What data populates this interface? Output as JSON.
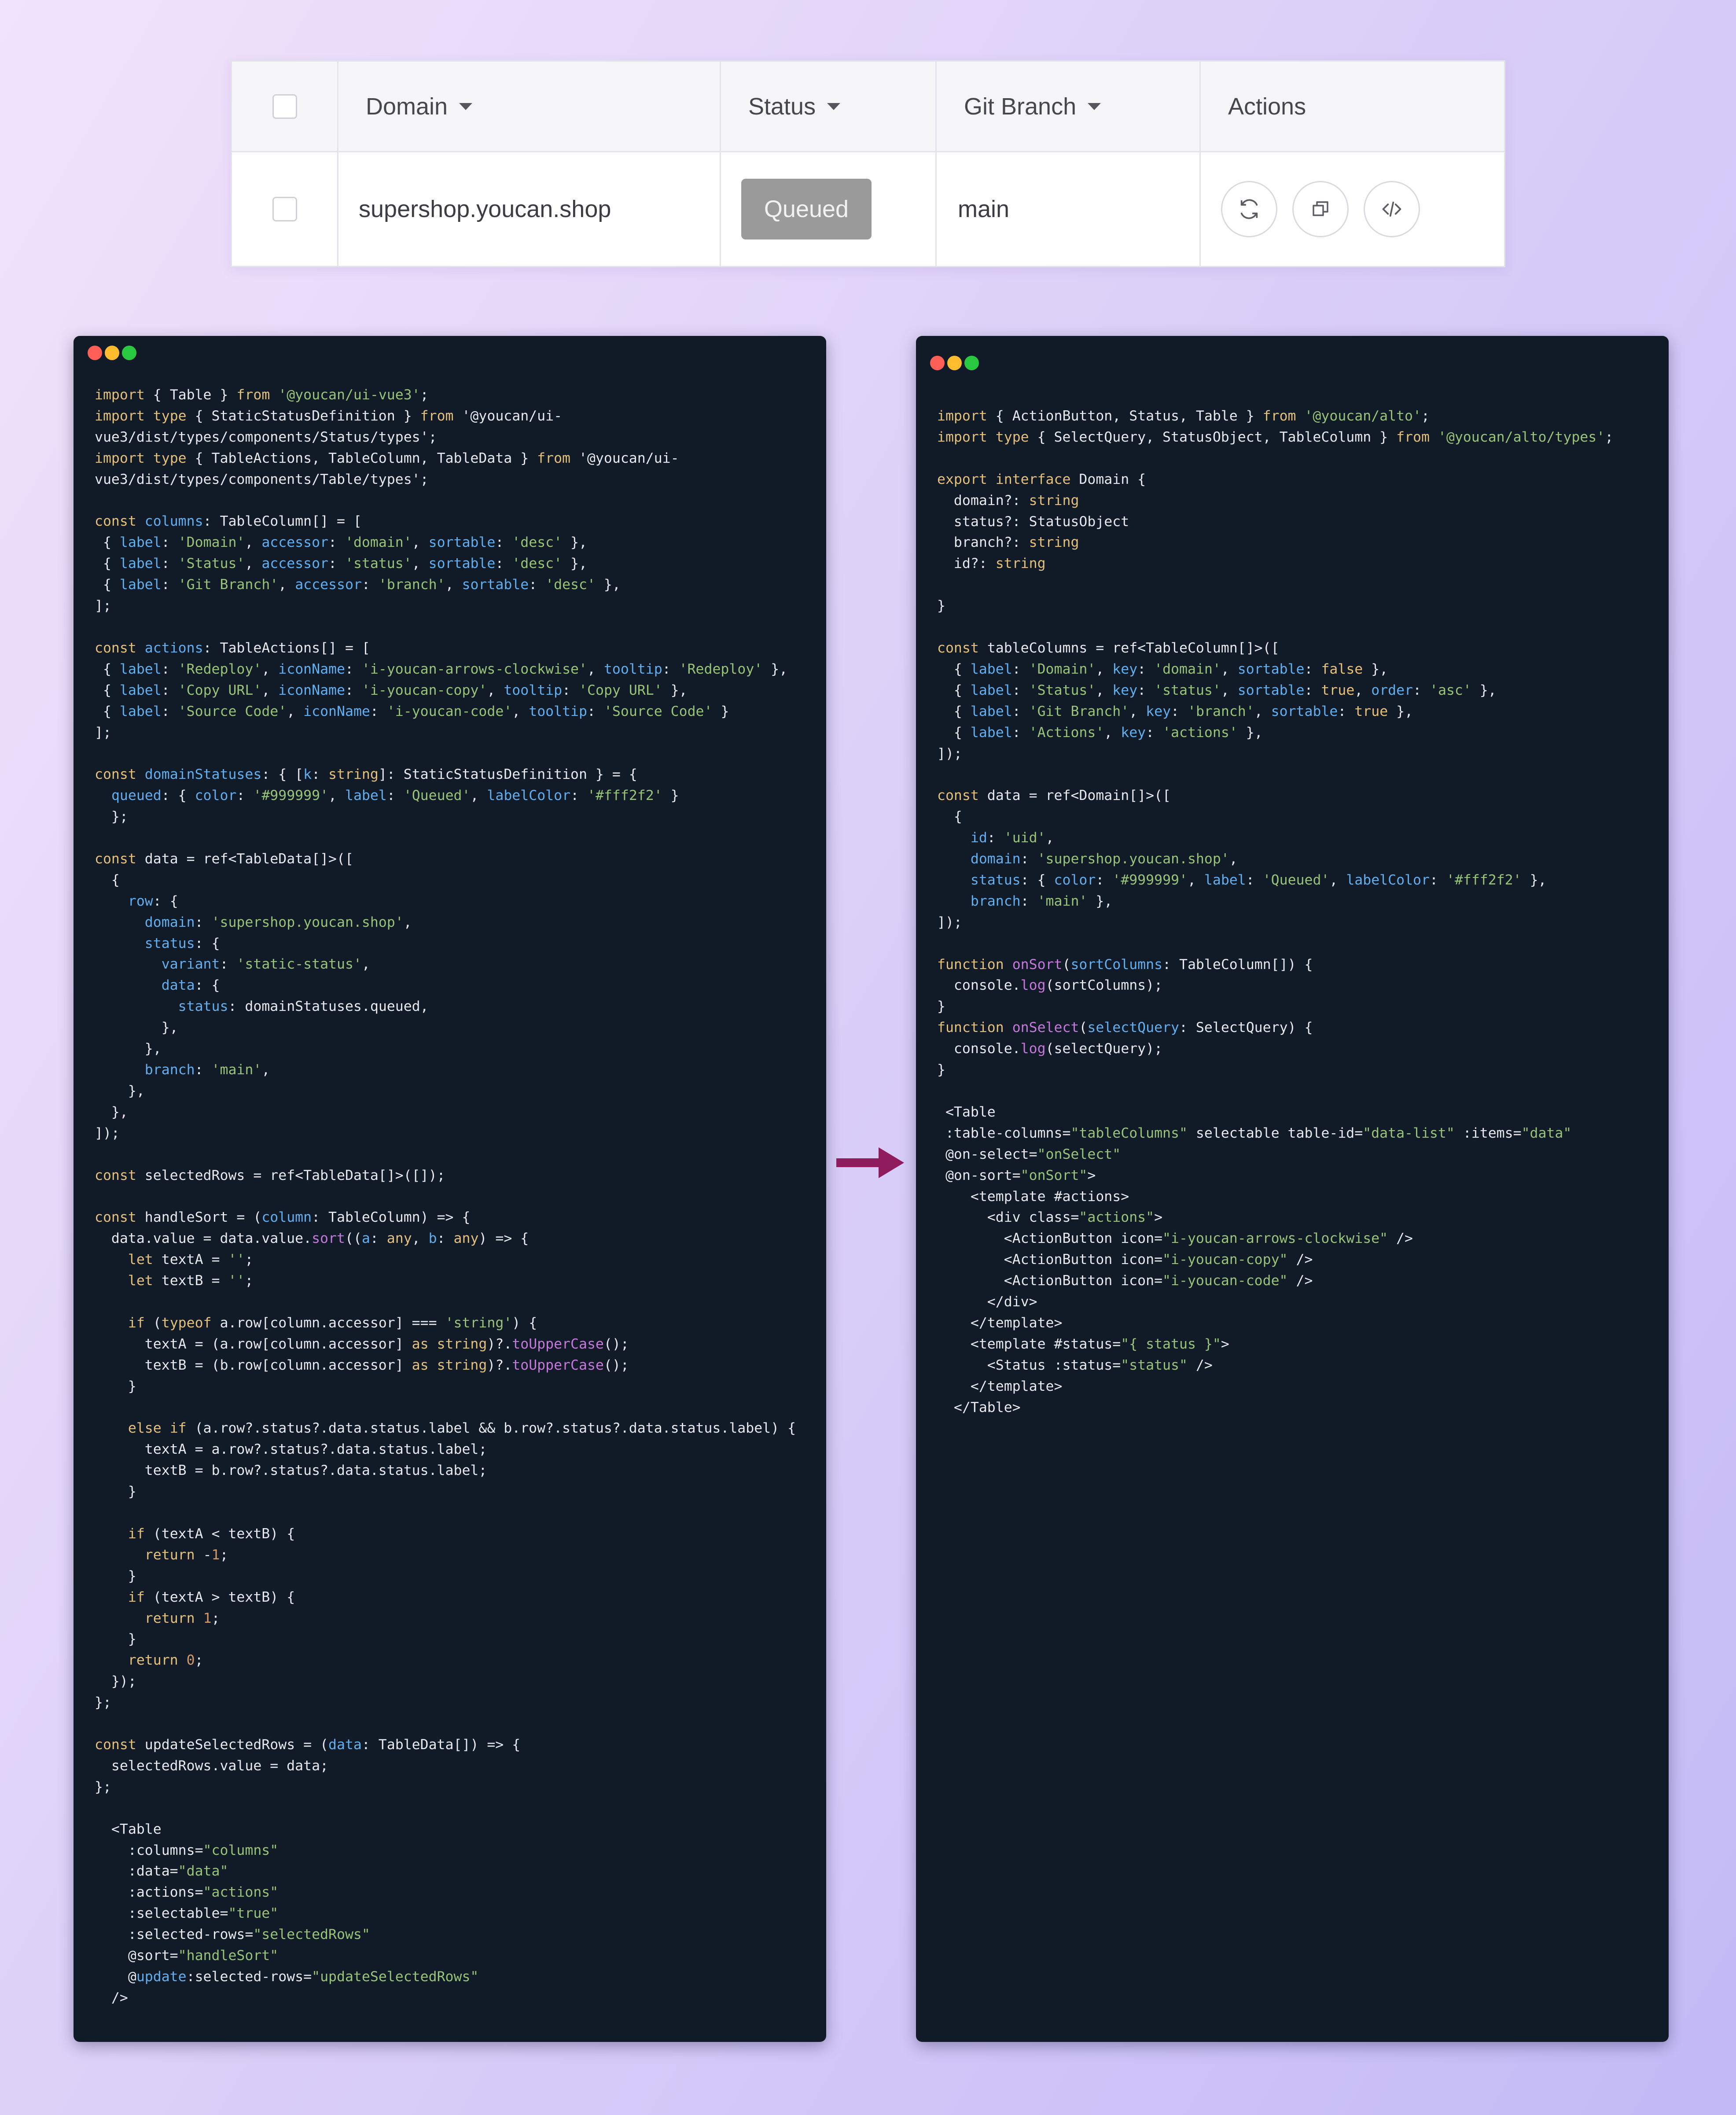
{
  "preview_table": {
    "headers": {
      "domain": "Domain",
      "status": "Status",
      "branch": "Git Branch",
      "actions": "Actions"
    },
    "row": {
      "domain": "supershop.youcan.shop",
      "status": "Queued",
      "branch": "main"
    },
    "action_icons": [
      "arrows-clockwise-icon",
      "copy-icon",
      "code-icon"
    ],
    "colors": {
      "status_badge_bg": "#9a9a9a",
      "status_badge_text": "#f2f2f2"
    }
  },
  "left_code": "import { Table } from '@youcan/ui-vue3';\nimport type { StaticStatusDefinition } from '@youcan/ui-\nvue3/dist/types/components/Status/types';\nimport type { TableActions, TableColumn, TableData } from '@youcan/ui-\nvue3/dist/types/components/Table/types';\n\nconst columns: TableColumn[] = [\n { label: 'Domain', accessor: 'domain', sortable: 'desc' },\n { label: 'Status', accessor: 'status', sortable: 'desc' },\n { label: 'Git Branch', accessor: 'branch', sortable: 'desc' },\n];\n\nconst actions: TableActions[] = [\n { label: 'Redeploy', iconName: 'i-youcan-arrows-clockwise', tooltip: 'Redeploy' },\n { label: 'Copy URL', iconName: 'i-youcan-copy', tooltip: 'Copy URL' },\n { label: 'Source Code', iconName: 'i-youcan-code', tooltip: 'Source Code' }\n];\n\nconst domainStatuses: { [k: string]: StaticStatusDefinition } = {\n  queued: { color: '#999999', label: 'Queued', labelColor: '#fff2f2' }\n  };\n\nconst data = ref<TableData[]>([\n  {\n    row: {\n      domain: 'supershop.youcan.shop',\n      status: {\n        variant: 'static-status',\n        data: {\n          status: domainStatuses.queued,\n        },\n      },\n      branch: 'main',\n    },\n  },\n]);\n\nconst selectedRows = ref<TableData[]>([]);\n\nconst handleSort = (column: TableColumn) => {\n  data.value = data.value.sort((a: any, b: any) => {\n    let textA = '';\n    let textB = '';\n\n    if (typeof a.row[column.accessor] === 'string') {\n      textA = (a.row[column.accessor] as string)?.toUpperCase();\n      textB = (b.row[column.accessor] as string)?.toUpperCase();\n    }\n\n    else if (a.row?.status?.data.status.label && b.row?.status?.data.status.label) {\n      textA = a.row?.status?.data.status.label;\n      textB = b.row?.status?.data.status.label;\n    }\n\n    if (textA < textB) {\n      return -1;\n    }\n    if (textA > textB) {\n      return 1;\n    }\n    return 0;\n  });\n};\n\nconst updateSelectedRows = (data: TableData[]) => {\n  selectedRows.value = data;\n};\n\n  <Table\n    :columns=\"columns\"\n    :data=\"data\"\n    :actions=\"actions\"\n    :selectable=\"true\"\n    :selected-rows=\"selectedRows\"\n    @sort=\"handleSort\"\n    @update:selected-rows=\"updateSelectedRows\"\n  />",
  "right_code": "import { ActionButton, Status, Table } from '@youcan/alto';\nimport type { SelectQuery, StatusObject, TableColumn } from '@youcan/alto/types';\n\nexport interface Domain {\n  domain?: string\n  status?: StatusObject\n  branch?: string\n  id?: string\n\n}\n\nconst tableColumns = ref<TableColumn[]>([\n  { label: 'Domain', key: 'domain', sortable: false },\n  { label: 'Status', key: 'status', sortable: true, order: 'asc' },\n  { label: 'Git Branch', key: 'branch', sortable: true },\n  { label: 'Actions', key: 'actions' },\n]);\n\nconst data = ref<Domain[]>([\n  {\n    id: 'uid',\n    domain: 'supershop.youcan.shop',\n    status: { color: '#999999', label: 'Queued', labelColor: '#fff2f2' },\n    branch: 'main' },\n]);\n\nfunction onSort(sortColumns: TableColumn[]) {\n  console.log(sortColumns);\n}\nfunction onSelect(selectQuery: SelectQuery) {\n  console.log(selectQuery);\n}\n\n <Table\n :table-columns=\"tableColumns\" selectable table-id=\"data-list\" :items=\"data\"\n @on-select=\"onSelect\"\n @on-sort=\"onSort\">\n    <template #actions>\n      <div class=\"actions\">\n        <ActionButton icon=\"i-youcan-arrows-clockwise\" />\n        <ActionButton icon=\"i-youcan-copy\" />\n        <ActionButton icon=\"i-youcan-code\" />\n      </div>\n    </template>\n    <template #status=\"{ status }\">\n      <Status :status=\"status\" />\n    </template>\n  </Table>"
}
